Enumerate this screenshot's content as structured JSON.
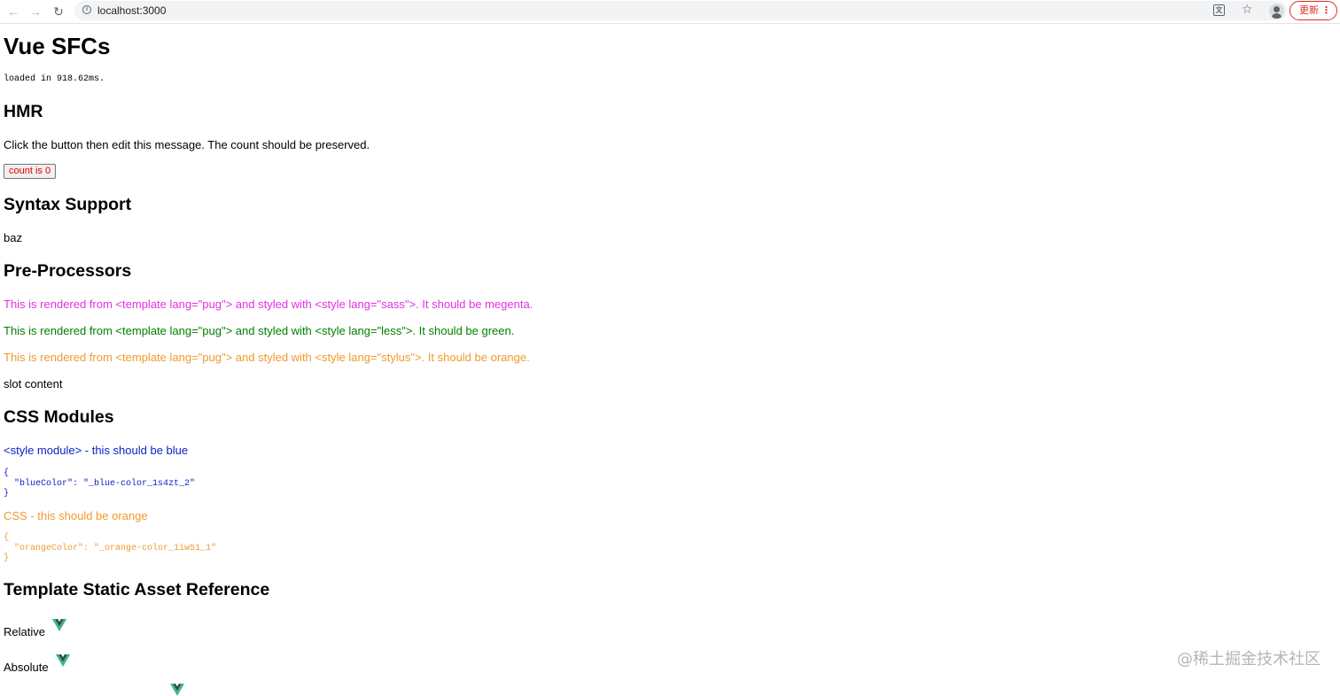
{
  "browser": {
    "url": "localhost:3000",
    "update_button_label": "更新",
    "update_menu_glyph": "⋮"
  },
  "page": {
    "title": "Vue SFCs",
    "load_time": "loaded in 918.62ms.",
    "hmr": {
      "heading": "HMR",
      "message": "Click the button then edit this message. The count should be preserved.",
      "button_label": "count is 0"
    },
    "syntax": {
      "heading": "Syntax Support",
      "text": "baz"
    },
    "preprocessors": {
      "heading": "Pre-Processors",
      "sass_line": "This is rendered from <template lang=\"pug\"> and styled with <style lang=\"sass\">. It should be megenta.",
      "less_line": "This is rendered from <template lang=\"pug\"> and styled with <style lang=\"less\">. It should be green.",
      "stylus_line": "This is rendered from <template lang=\"pug\"> and styled with <style lang=\"stylus\">. It should be orange.",
      "slot_text": "slot content"
    },
    "css_modules": {
      "heading": "CSS Modules",
      "module_line": "<style module> - this should be blue",
      "module_json": "{\n  \"blueColor\": \"_blue-color_1s4zt_2\"\n}",
      "css_line": "CSS - this should be orange",
      "css_json": "{\n  \"orangeColor\": \"_orange-color_1iw51_1\"\n}"
    },
    "static_assets": {
      "heading": "Template Static Asset Reference",
      "relative_label": "Relative",
      "absolute_label": "Absolute"
    }
  },
  "watermark": "@稀土掘金技术社区",
  "colors": {
    "magenta": "#e231e2",
    "green": "#008000",
    "orange": "#f09a2d",
    "blue": "#0b22c7",
    "button_text": "#e00000",
    "vue_green": "#41b883",
    "vue_dark": "#35495e"
  }
}
